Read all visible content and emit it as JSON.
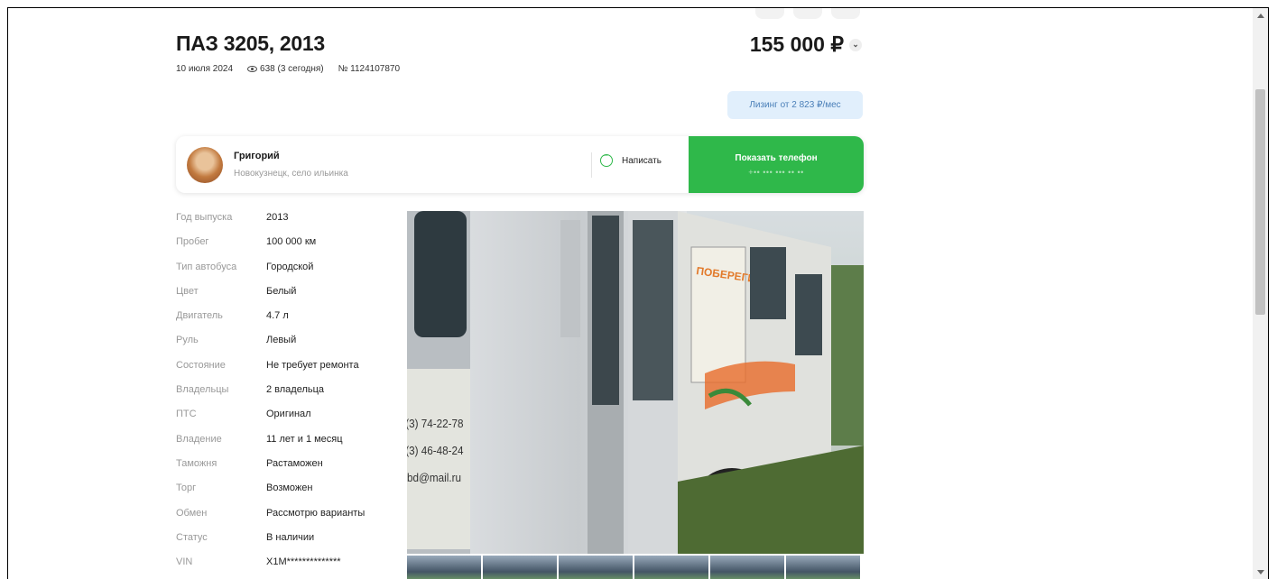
{
  "listing": {
    "title": "ПАЗ 3205, 2013",
    "date": "10 июля 2024",
    "views": "638 (3 сегодня)",
    "number": "№ 1124107870",
    "price": "155 000 ₽",
    "leasing": "Лизинг от 2 823 ₽/мес"
  },
  "seller": {
    "name": "Григорий",
    "location": "Новокузнецк, село ильинка",
    "write_label": "Написать",
    "phone_label": "Показать телефон",
    "phone_mask": "+•• ••• ••• •• ••"
  },
  "specs": [
    {
      "label": "Год выпуска",
      "value": "2013"
    },
    {
      "label": "Пробег",
      "value": "100 000 км"
    },
    {
      "label": "Тип автобуса",
      "value": "Городской"
    },
    {
      "label": "Цвет",
      "value": "Белый"
    },
    {
      "label": "Двигатель",
      "value": "4.7 л"
    },
    {
      "label": "Руль",
      "value": "Левый"
    },
    {
      "label": "Состояние",
      "value": "Не требует ремонта"
    },
    {
      "label": "Владельцы",
      "value": "2 владельца"
    },
    {
      "label": "ПТС",
      "value": "Оригинал"
    },
    {
      "label": "Владение",
      "value": "11 лет и 1 месяц"
    },
    {
      "label": "Таможня",
      "value": "Растаможен"
    },
    {
      "label": "Торг",
      "value": "Возможен"
    },
    {
      "label": "Обмен",
      "value": "Рассмотрю варианты"
    },
    {
      "label": "Статус",
      "value": "В наличии"
    },
    {
      "label": "VIN",
      "value": "X1M**************"
    }
  ],
  "photo": {
    "bus_side_text_1": "ПОБЕРЕГИ",
    "bus_phone_1": "(3) 74-22-78",
    "bus_phone_2": "(3) 46-48-24",
    "bus_email": "bd@mail.ru"
  },
  "colors": {
    "accent_green": "#2fb84a",
    "leasing_bg": "#e1effc",
    "leasing_text": "#4a7fb8"
  }
}
